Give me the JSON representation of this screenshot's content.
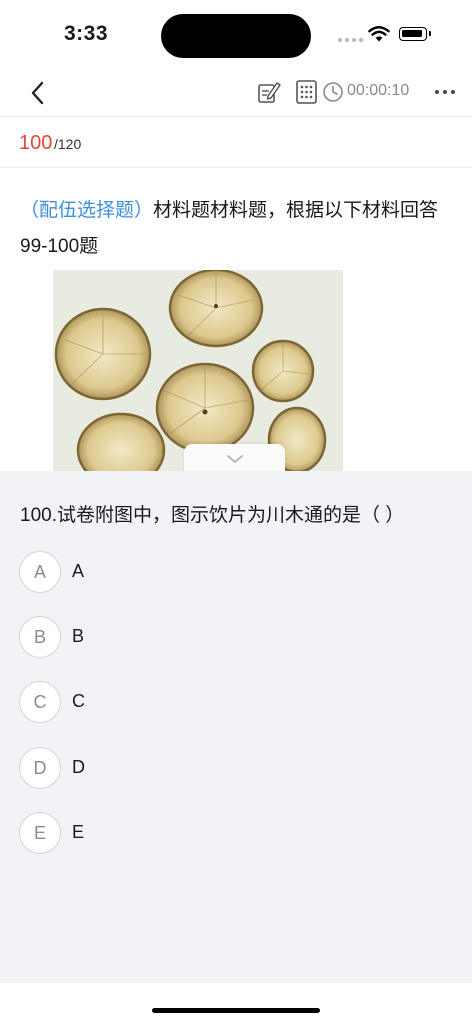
{
  "status_bar": {
    "time": "3:33"
  },
  "nav": {
    "timer": "00:00:10"
  },
  "progress": {
    "current": "100",
    "total": "/120"
  },
  "stem": {
    "tag": "（配伍选择题）",
    "text": "材料题材料题，根据以下材料回答99-100题"
  },
  "question": {
    "title": "100.试卷附图中，图示饮片为川木通的是（ ）",
    "options": [
      {
        "letter": "A",
        "text": "A"
      },
      {
        "letter": "B",
        "text": "B"
      },
      {
        "letter": "C",
        "text": "C"
      },
      {
        "letter": "D",
        "text": "D"
      },
      {
        "letter": "E",
        "text": "E"
      }
    ]
  },
  "colors": {
    "accent_red": "#e8453c",
    "tag_blue": "#3d8fe0",
    "panel_bg": "#f2f3f7"
  },
  "icons": [
    "back-icon",
    "answer-sheet-edit-icon",
    "grid-icon",
    "clock-icon",
    "more-icon",
    "chevron-down-icon",
    "wifi-icon",
    "battery-icon"
  ]
}
